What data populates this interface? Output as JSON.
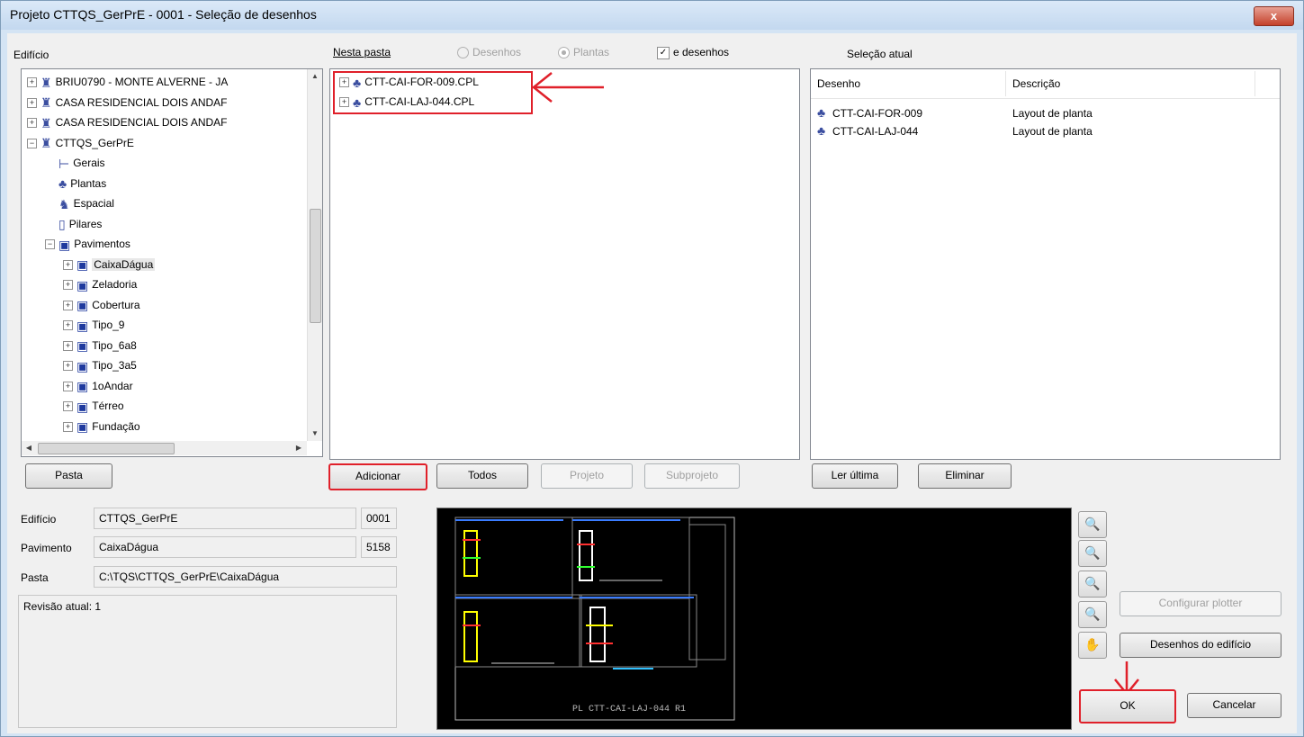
{
  "window": {
    "title": "Projeto CTTQS_GerPrE - 0001 - Seleção de desenhos",
    "close_label": "x"
  },
  "left": {
    "label": "Edifício",
    "tree": [
      {
        "label": "BRIU0790 - MONTE ALVERNE - JA",
        "icon": "building-icon",
        "expander": "+"
      },
      {
        "label": "CASA RESIDENCIAL DOIS ANDAF",
        "icon": "building-icon",
        "expander": "+"
      },
      {
        "label": "CASA RESIDENCIAL DOIS ANDAF",
        "icon": "building-icon",
        "expander": "+"
      },
      {
        "label": "CTTQS_GerPrE",
        "icon": "building-icon",
        "expander": "−"
      },
      {
        "label": "Gerais",
        "icon": "gerais-icon"
      },
      {
        "label": "Plantas",
        "icon": "plantas-icon"
      },
      {
        "label": "Espacial",
        "icon": "espacial-icon"
      },
      {
        "label": "Pilares",
        "icon": "pilares-icon"
      },
      {
        "label": "Pavimentos",
        "icon": "pavimento-icon",
        "expander": "−"
      },
      {
        "label": "CaixaDágua",
        "icon": "pavimento-icon",
        "expander": "+",
        "selected": true
      },
      {
        "label": "Zeladoria",
        "icon": "pavimento-icon",
        "expander": "+"
      },
      {
        "label": "Cobertura",
        "icon": "pavimento-icon",
        "expander": "+"
      },
      {
        "label": "Tipo_9",
        "icon": "pavimento-icon",
        "expander": "+"
      },
      {
        "label": "Tipo_6a8",
        "icon": "pavimento-icon",
        "expander": "+"
      },
      {
        "label": "Tipo_3a5",
        "icon": "pavimento-icon",
        "expander": "+"
      },
      {
        "label": "1oAndar",
        "icon": "pavimento-icon",
        "expander": "+"
      },
      {
        "label": "Térreo",
        "icon": "pavimento-icon",
        "expander": "+"
      },
      {
        "label": "Fundação",
        "icon": "pavimento-icon",
        "expander": "+"
      }
    ],
    "pasta_button": "Pasta"
  },
  "middle": {
    "label": "Nesta pasta",
    "radio_desenhos": "Desenhos",
    "radio_plantas": "Plantas",
    "checkbox_label": "e desenhos",
    "checkbox_mark": "✓",
    "files": [
      {
        "label": "CTT-CAI-FOR-009.CPL"
      },
      {
        "label": "CTT-CAI-LAJ-044.CPL"
      }
    ],
    "buttons": {
      "adicionar": "Adicionar",
      "todos": "Todos",
      "projeto": "Projeto",
      "subprojeto": "Subprojeto"
    }
  },
  "right": {
    "label": "Seleção atual",
    "columns": [
      "Desenho",
      "Descrição"
    ],
    "rows": [
      {
        "desenho": "CTT-CAI-FOR-009",
        "descricao": "Layout de planta"
      },
      {
        "desenho": "CTT-CAI-LAJ-044",
        "descricao": "Layout de planta"
      }
    ],
    "buttons": {
      "ler_ultima": "Ler última",
      "eliminar": "Eliminar"
    }
  },
  "info": {
    "edificio_label": "Edifício",
    "edificio_value": "CTTQS_GerPrE",
    "edificio_code": "0001",
    "pavimento_label": "Pavimento",
    "pavimento_value": "CaixaDágua",
    "pavimento_code": "5158",
    "pasta_label": "Pasta",
    "pasta_value": "C:\\TQS\\CTTQS_GerPrE\\CaixaDágua",
    "revisao": "Revisão atual: 1"
  },
  "preview": {
    "caption": "PL  CTT-CAI-LAJ-044  R1"
  },
  "actions": {
    "configurar_plotter": "Configurar plotter",
    "desenhos_edificio": "Desenhos do edifício",
    "ok": "OK",
    "cancelar": "Cancelar"
  },
  "colors": {
    "highlight": "#e0202a",
    "selection": "#3399ff",
    "preview_bg": "#000000"
  }
}
